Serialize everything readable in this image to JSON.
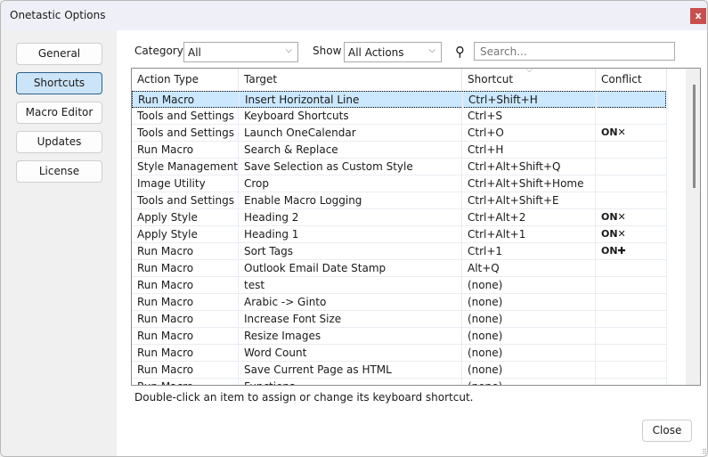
{
  "window": {
    "title": "Onetastic Options",
    "close_glyph": "x"
  },
  "nav": {
    "items": [
      {
        "label": "General"
      },
      {
        "label": "Shortcuts",
        "selected": true
      },
      {
        "label": "Macro Editor"
      },
      {
        "label": "Updates"
      },
      {
        "label": "License"
      }
    ]
  },
  "filters": {
    "category_label": "Category",
    "category_value": "All",
    "show_label": "Show",
    "show_value": "All Actions",
    "search_placeholder": "Search..."
  },
  "table": {
    "columns": [
      "Action Type",
      "Target",
      "Shortcut",
      "Conflict"
    ],
    "sorted_column": "Shortcut",
    "rows": [
      {
        "type": "Run Macro",
        "target": "Insert Horizontal Line",
        "shortcut": "Ctrl+Shift+H",
        "conflict": "",
        "selected": true
      },
      {
        "type": "Tools and Settings",
        "target": "Keyboard Shortcuts",
        "shortcut": "Ctrl+S",
        "conflict": ""
      },
      {
        "type": "Tools and Settings",
        "target": "Launch OneCalendar",
        "shortcut": "Ctrl+O",
        "conflict": "ON✕"
      },
      {
        "type": "Run Macro",
        "target": "Search & Replace",
        "shortcut": "Ctrl+H",
        "conflict": ""
      },
      {
        "type": "Style Management",
        "target": "Save Selection as Custom Style",
        "shortcut": "Ctrl+Alt+Shift+Q",
        "conflict": ""
      },
      {
        "type": "Image Utility",
        "target": "Crop",
        "shortcut": "Ctrl+Alt+Shift+Home",
        "conflict": ""
      },
      {
        "type": "Tools and Settings",
        "target": "Enable Macro Logging",
        "shortcut": "Ctrl+Alt+Shift+E",
        "conflict": ""
      },
      {
        "type": "Apply Style",
        "target": "Heading 2",
        "shortcut": "Ctrl+Alt+2",
        "conflict": "ON✕"
      },
      {
        "type": "Apply Style",
        "target": "Heading 1",
        "shortcut": "Ctrl+Alt+1",
        "conflict": "ON✕"
      },
      {
        "type": "Run Macro",
        "target": "Sort Tags",
        "shortcut": "Ctrl+1",
        "conflict": "ON✚"
      },
      {
        "type": "Run Macro",
        "target": "Outlook Email Date Stamp",
        "shortcut": "Alt+Q",
        "conflict": ""
      },
      {
        "type": "Run Macro",
        "target": "test",
        "shortcut": "(none)",
        "conflict": ""
      },
      {
        "type": "Run Macro",
        "target": "Arabic -> Ginto",
        "shortcut": "(none)",
        "conflict": ""
      },
      {
        "type": "Run Macro",
        "target": "Increase Font Size",
        "shortcut": "(none)",
        "conflict": ""
      },
      {
        "type": "Run Macro",
        "target": "Resize Images",
        "shortcut": "(none)",
        "conflict": ""
      },
      {
        "type": "Run Macro",
        "target": "Word Count",
        "shortcut": "(none)",
        "conflict": ""
      },
      {
        "type": "Run Macro",
        "target": "Save Current Page as HTML",
        "shortcut": "(none)",
        "conflict": ""
      },
      {
        "type": "Run Macro",
        "target": "Functions",
        "shortcut": "(none)",
        "conflict": ""
      }
    ]
  },
  "hint": "Double-click an item to assign or change its keyboard shortcut.",
  "close_label": "Close",
  "colors": {
    "selected_row": "#cce8ff",
    "selected_nav": "#cce4f7",
    "close_x": "#c94f4f"
  }
}
